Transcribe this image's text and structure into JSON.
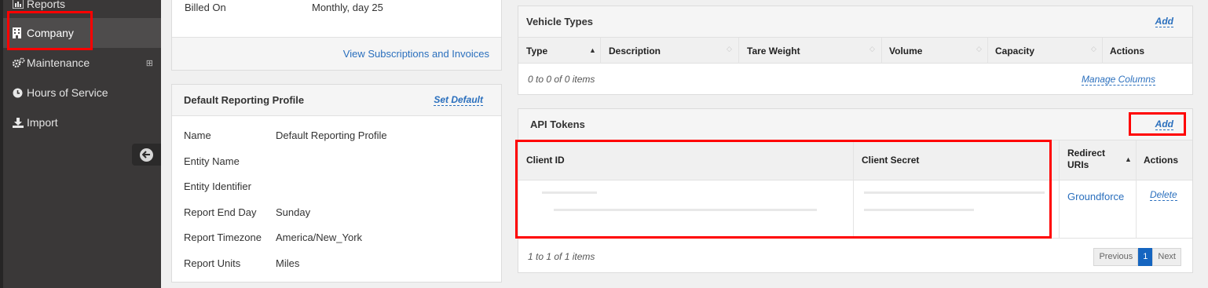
{
  "sidebar": {
    "items": [
      {
        "label": "Reports",
        "icon": "bar-chart-icon"
      },
      {
        "label": "Company",
        "icon": "building-icon"
      },
      {
        "label": "Maintenance",
        "icon": "gears-icon",
        "expand": "⊞"
      },
      {
        "label": "Hours of Service",
        "icon": "clock-icon"
      },
      {
        "label": "Import",
        "icon": "download-icon"
      }
    ],
    "collapse_glyph": "➜"
  },
  "billing": {
    "billed_on_label": "Billed On",
    "billed_on_value": "Monthly, day 25",
    "view_link": "View Subscriptions and Invoices"
  },
  "reporting_profile": {
    "title": "Default Reporting Profile",
    "set_default": "Set Default",
    "rows": [
      {
        "label": "Name",
        "value": "Default Reporting Profile"
      },
      {
        "label": "Entity Name",
        "value": ""
      },
      {
        "label": "Entity Identifier",
        "value": ""
      },
      {
        "label": "Report End Day",
        "value": "Sunday"
      },
      {
        "label": "Report Timezone",
        "value": "America/New_York"
      },
      {
        "label": "Report Units",
        "value": "Miles"
      }
    ]
  },
  "vehicle_types": {
    "title": "Vehicle Types",
    "add": "Add",
    "columns": [
      "Type",
      "Description",
      "Tare Weight",
      "Volume",
      "Capacity",
      "Actions"
    ],
    "items_note": "0 to 0 of 0 items",
    "manage_columns": "Manage Columns"
  },
  "api_tokens": {
    "title": "API Tokens",
    "add": "Add",
    "columns": [
      "Client ID",
      "Client Secret",
      "Redirect URIs",
      "Actions"
    ],
    "row": {
      "redirect": "Groundforce",
      "action": "Delete"
    },
    "items_note": "1 to 1 of 1 items",
    "pager": {
      "previous": "Previous",
      "page": "1",
      "next": "Next"
    }
  },
  "colors": {
    "accent_link": "#2a6fbd",
    "highlight": "#ff0000",
    "active_page": "#1565c0"
  }
}
